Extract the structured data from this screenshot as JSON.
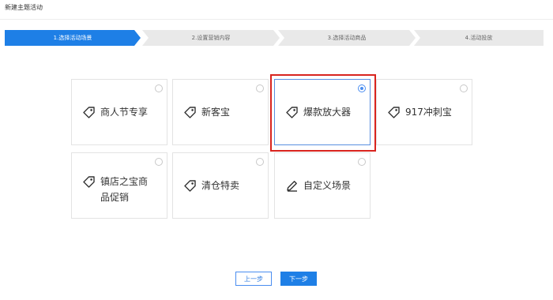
{
  "header": {
    "title": "新建主题活动"
  },
  "stepper": {
    "steps": [
      {
        "label": "1.选择活动场景",
        "active": true
      },
      {
        "label": "2.设置营销内容",
        "active": false
      },
      {
        "label": "3.选择活动商品",
        "active": false
      },
      {
        "label": "4.活动投放",
        "active": false
      }
    ]
  },
  "options": [
    {
      "label": "商人节专享",
      "icon": "tag-icon",
      "selected": false
    },
    {
      "label": "新客宝",
      "icon": "tag-icon",
      "selected": false
    },
    {
      "label": "爆款放大器",
      "icon": "tag-icon",
      "selected": true
    },
    {
      "label": "917冲刺宝",
      "icon": "tag-icon",
      "selected": false
    },
    {
      "label": "镇店之宝商品促销",
      "icon": "tag-icon",
      "selected": false
    },
    {
      "label": "清仓特卖",
      "icon": "tag-icon",
      "selected": false
    },
    {
      "label": "自定义场景",
      "icon": "edit-icon",
      "selected": false
    }
  ],
  "footer": {
    "prev_label": "上一步",
    "next_label": "下一步"
  },
  "colors": {
    "accent": "#1e7fe6",
    "step_inactive": "#e9e9e9",
    "highlight": "#d9241e"
  }
}
